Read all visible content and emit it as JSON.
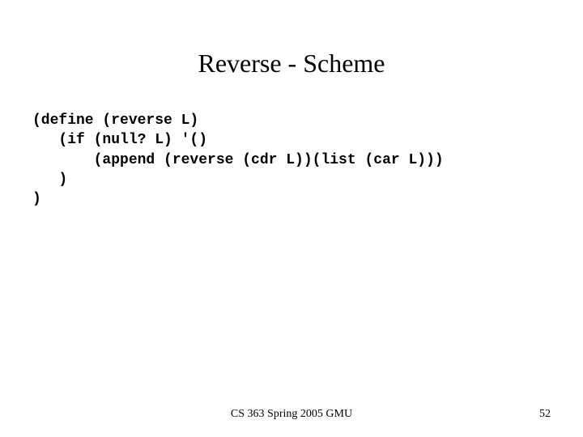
{
  "slide": {
    "title": "Reverse - Scheme",
    "code": "(define (reverse L)\n   (if (null? L) '()\n       (append (reverse (cdr L))(list (car L)))\n   )\n)",
    "footer": "CS 363 Spring 2005 GMU",
    "page_number": "52"
  }
}
